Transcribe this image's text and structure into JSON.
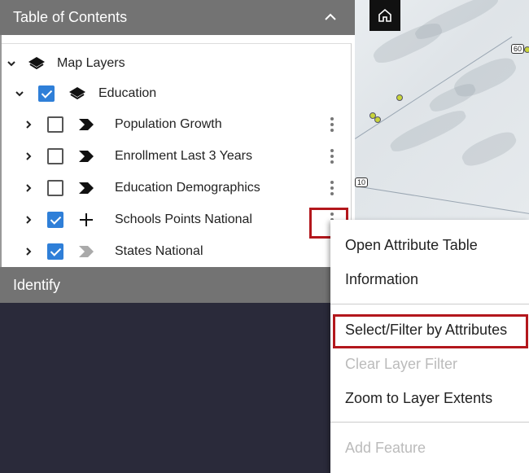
{
  "toc": {
    "title": "Table of Contents",
    "collapse_icon": "chevron-up-icon",
    "root": {
      "label": "Map Layers",
      "icon": "layers-icon",
      "expanded": true
    },
    "group": {
      "label": "Education",
      "icon": "layers-icon",
      "checked": true,
      "expanded": true
    },
    "layers": [
      {
        "label": "Population Growth",
        "checked": false,
        "symbol": "chevron-arrow-black"
      },
      {
        "label": "Enrollment Last 3 Years",
        "checked": false,
        "symbol": "chevron-arrow-black"
      },
      {
        "label": "Education Demographics",
        "checked": false,
        "symbol": "chevron-arrow-black"
      },
      {
        "label": "Schools Points National",
        "checked": true,
        "symbol": "plus-icon"
      },
      {
        "label": "States National",
        "checked": true,
        "symbol": "chevron-arrow-gray"
      }
    ]
  },
  "identify": {
    "title": "Identify"
  },
  "map": {
    "home_icon": "home-icon",
    "shield_60": "60",
    "shield_10": "10"
  },
  "context_menu": {
    "items": [
      {
        "label": "Open Attribute Table",
        "enabled": true
      },
      {
        "label": "Information",
        "enabled": true
      },
      {
        "label": "Select/Filter by Attributes",
        "enabled": true,
        "highlighted": true
      },
      {
        "label": "Clear Layer Filter",
        "enabled": false
      },
      {
        "label": "Zoom to Layer Extents",
        "enabled": true
      },
      {
        "label": "Add Feature",
        "enabled": false
      }
    ]
  },
  "colors": {
    "header_bg": "#737373",
    "checkbox_on": "#2f7fd8",
    "highlight": "#b3171c",
    "background": "#2a2a3a"
  }
}
